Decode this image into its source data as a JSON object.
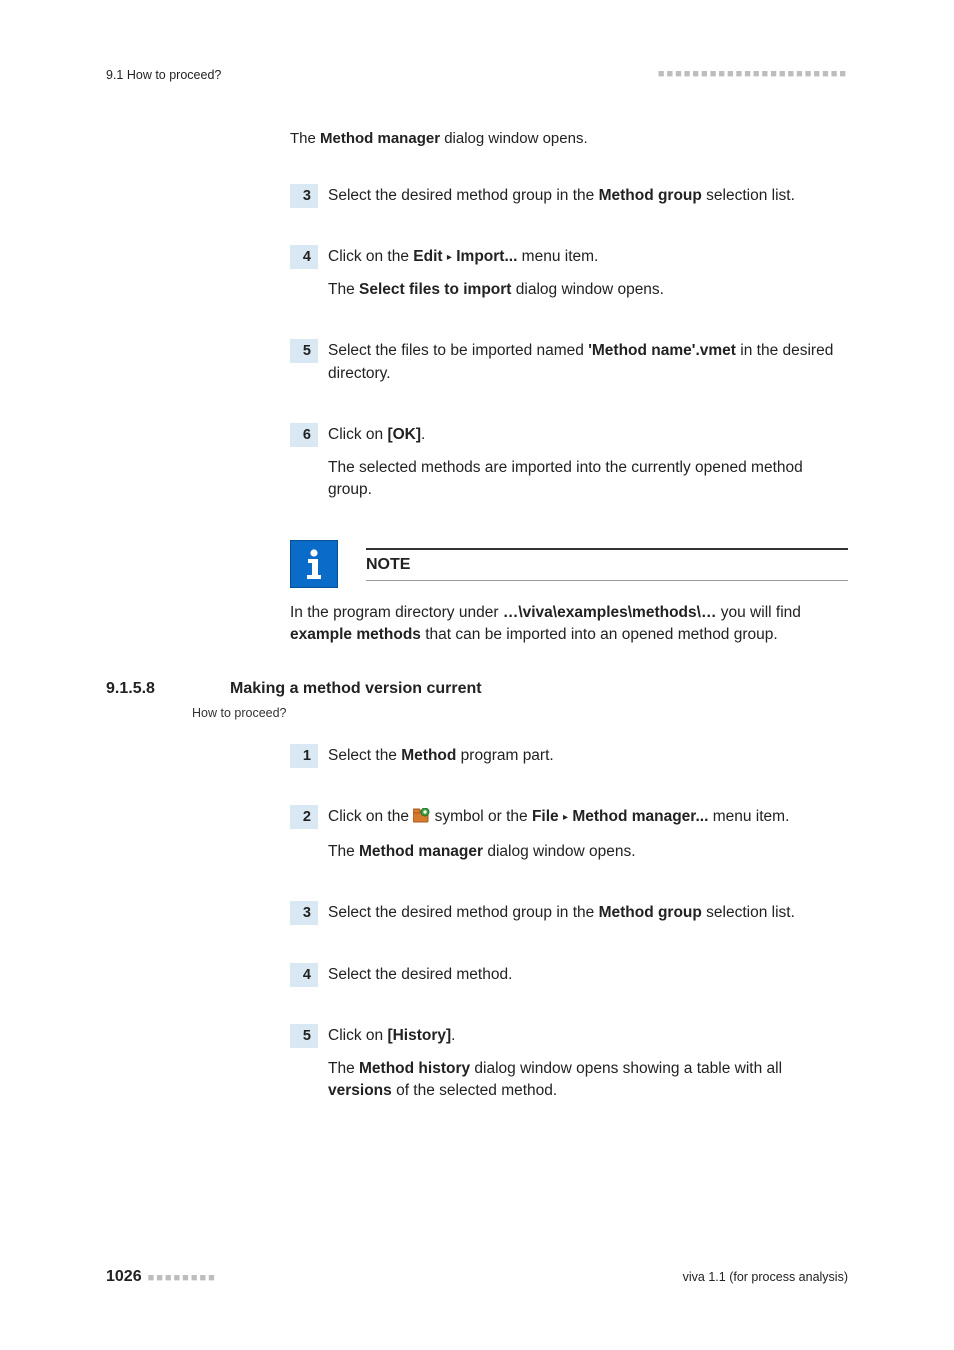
{
  "header": {
    "left": "9.1 How to proceed?",
    "dots": "■■■■■■■■■■■■■■■■■■■■■■"
  },
  "blockA": {
    "intro_pre": "The ",
    "intro_b": "Method manager",
    "intro_post": " dialog window opens.",
    "s3": {
      "n": "3",
      "t1": "Select the desired method group in the ",
      "t1b": "Method group",
      "t1post": " selection list."
    },
    "s4": {
      "n": "4",
      "t1a": "Click on the ",
      "t1b": "Edit",
      "tri": "▸",
      "t1c": "Import...",
      "t1d": " menu item.",
      "r_pre": "The ",
      "r_b": "Select files to import",
      "r_post": " dialog window opens."
    },
    "s5": {
      "n": "5",
      "t1a": "Select the files to be imported named ",
      "t1b": "'Method name'.vmet",
      "t1c": " in the desired directory."
    },
    "s6": {
      "n": "6",
      "t1a": "Click on ",
      "t1b": "[OK]",
      "t1c": ".",
      "r": "The selected methods are imported into the currently opened method group."
    }
  },
  "note": {
    "title": "NOTE",
    "p1a": "In the program directory under ",
    "p1b": "…\\viva\\examples\\methods\\…",
    "p1c": " you will find ",
    "p1d": "example methods",
    "p1e": " that can be imported into an opened method group."
  },
  "section": {
    "num": "9.1.5.8",
    "title": "Making a method version current",
    "howto": "How to proceed?"
  },
  "blockB": {
    "s1": {
      "n": "1",
      "a": "Select the ",
      "b": "Method",
      "c": " program part."
    },
    "s2": {
      "n": "2",
      "a": "Click on the ",
      "b": " symbol or the ",
      "c": "File",
      "tri": "▸",
      "d": "Method manager...",
      "e": " menu item.",
      "r_pre": "The ",
      "r_b": "Method manager",
      "r_post": " dialog window opens."
    },
    "s3": {
      "n": "3",
      "a": "Select the desired method group in the ",
      "b": "Method group",
      "c": " selection list."
    },
    "s4": {
      "n": "4",
      "a": "Select the desired method."
    },
    "s5": {
      "n": "5",
      "a": "Click on ",
      "b": "[History]",
      "c": ".",
      "r1a": "The ",
      "r1b": "Method history",
      "r1c": " dialog window opens showing a table with all ",
      "r1d": "versions",
      "r1e": " of the selected method."
    }
  },
  "footer": {
    "page": "1026",
    "dots": "■■■■■■■■",
    "right": "viva 1.1 (for process analysis)"
  }
}
